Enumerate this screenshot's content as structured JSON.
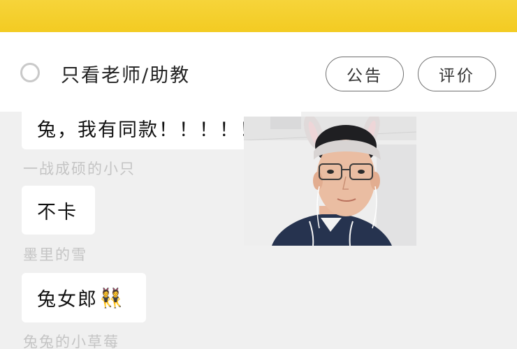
{
  "header": {
    "background": "#f3cb22"
  },
  "filter": {
    "teacher_only_label": "只看老师/助教",
    "notice_label": "公告",
    "rate_label": "评价"
  },
  "messages": [
    {
      "text": "兔，我有同款！！！！！！",
      "sender": "一战成硕的小只"
    },
    {
      "text": "不卡",
      "sender": "墨里的雪"
    },
    {
      "text": "兔女郎",
      "emoji": "👯",
      "sender": "兔兔的小草莓"
    }
  ],
  "video": {
    "icon": "teacher-video-feed"
  }
}
